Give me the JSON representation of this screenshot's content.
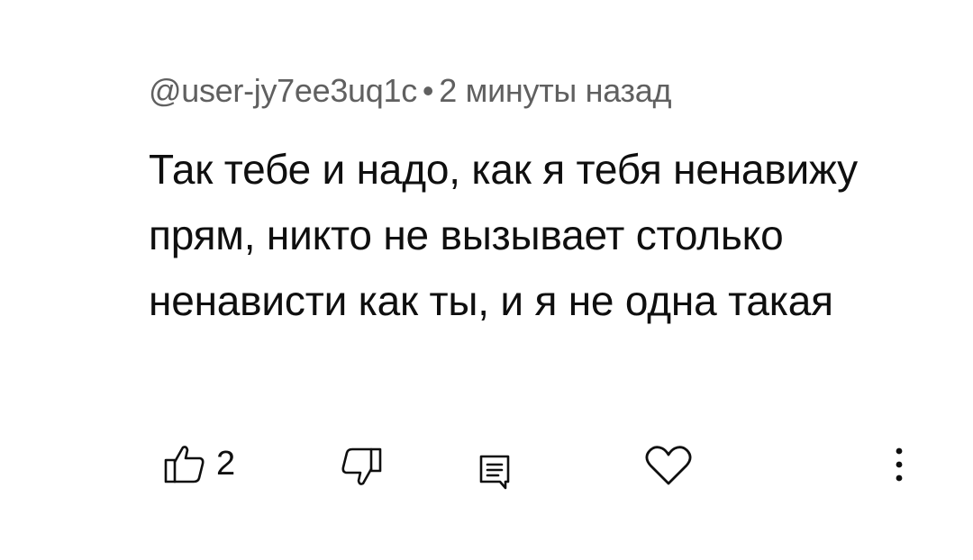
{
  "comment": {
    "author": "@user-jy7ee3uq1c",
    "separator": "•",
    "timestamp": "2 минуты назад",
    "text": "Так тебе и надо, как я тебя ненавижу прям, никто не вызывает столько ненависти как ты, и я не одна такая",
    "likes": "2"
  },
  "icons": {
    "like": "thumbs-up-icon",
    "dislike": "thumbs-down-icon",
    "reply": "reply-icon",
    "heart": "heart-icon",
    "more": "more-vert-icon"
  },
  "colors": {
    "meta_text": "#606060",
    "body_text": "#0f0f0f",
    "icon_stroke": "#0f0f0f"
  }
}
